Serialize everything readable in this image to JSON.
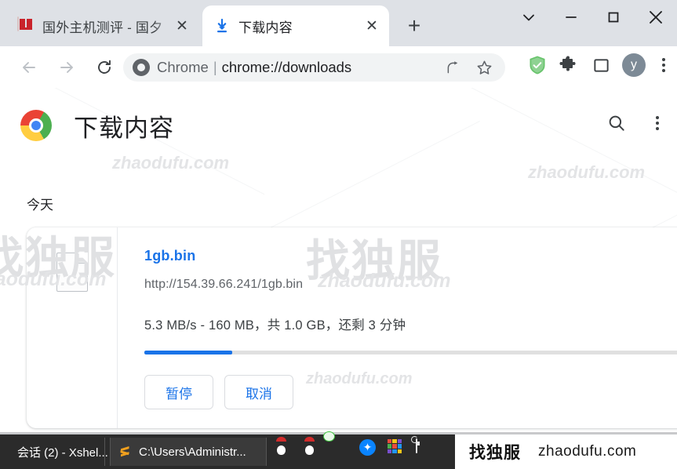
{
  "browser": {
    "tabs": [
      {
        "title": "国外主机测评 - 国夕",
        "favicon": "site-favicon",
        "active": false,
        "close_label": "✕"
      },
      {
        "title": "下载内容",
        "favicon": "download-icon",
        "active": true,
        "close_label": "✕"
      }
    ],
    "new_tab_label": "+",
    "window_controls": {
      "tab_search": "chevron-down-icon",
      "minimize": "minimize-icon",
      "maximize": "maximize-icon",
      "close": "close-icon"
    },
    "navigation": {
      "back": "back-arrow-icon",
      "forward": "forward-arrow-icon",
      "reload": "reload-icon"
    },
    "omnibox": {
      "leading_icon": "chrome-icon",
      "label": "Chrome",
      "separator": "|",
      "url": "chrome://downloads",
      "share_icon": "share-icon",
      "bookmark_icon": "star-icon"
    },
    "extensions": {
      "adguard": "shield-check-icon",
      "puzzle": "extensions-puzzle-icon",
      "side_panel": "side-panel-icon",
      "avatar_initial": "y",
      "menu": "three-dot-menu-icon"
    }
  },
  "page": {
    "logo": "chrome-logo",
    "title": "下载内容",
    "search_icon": "search-icon",
    "menu_icon": "three-dot-menu-icon",
    "section_label": "今天",
    "download": {
      "file_icon": "generic-file-icon",
      "name": "1gb.bin",
      "url": "http://154.39.66.241/1gb.bin",
      "status": "5.3 MB/s - 160 MB，共 1.0 GB，还剩 3 分钟",
      "progress_percent": 16,
      "buttons": [
        {
          "label": "暂停",
          "name": "pause-button"
        },
        {
          "label": "取消",
          "name": "cancel-button"
        }
      ]
    }
  },
  "watermarks": {
    "site": "zhaodufu.com",
    "brand_zh": "找独服"
  },
  "taskbar": {
    "items": [
      {
        "label": "会话 (2) - Xshel...",
        "icon": "xshell-icon"
      },
      {
        "label": "C:\\Users\\Administr...",
        "icon": "sublime-icon"
      }
    ],
    "tray": [
      "qq-icon",
      "qq-icon",
      "wechat-icon",
      "bluetooth-icon",
      "color-grid-icon",
      "battery-icon"
    ]
  },
  "brand_footer": {
    "zh": "找独服",
    "en": "zhaodufu.com"
  },
  "colors": {
    "accent_blue": "#1a73e8",
    "titlebar": "#dee1e6",
    "omnibox": "#f1f3f4",
    "taskbar": "#2b2b2b"
  }
}
